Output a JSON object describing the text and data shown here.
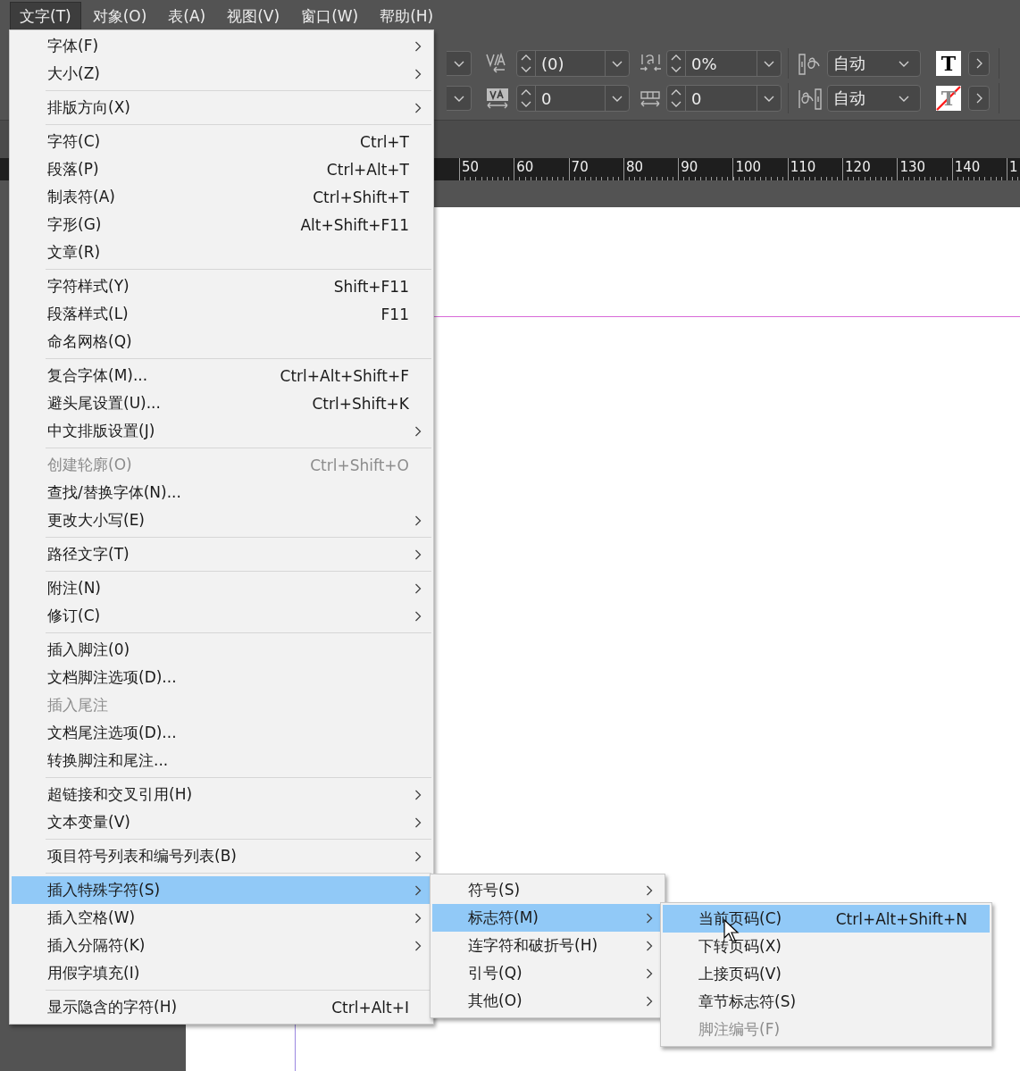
{
  "menubar": [
    {
      "label": "文字(T)",
      "selected": true
    },
    {
      "label": "对象(O)",
      "selected": false
    },
    {
      "label": "表(A)",
      "selected": false
    },
    {
      "label": "视图(V)",
      "selected": false
    },
    {
      "label": "窗口(W)",
      "selected": false
    },
    {
      "label": "帮助(H)",
      "selected": false
    }
  ],
  "control_panel": {
    "rows": [
      {
        "fields": [
          {
            "kind": "spinner",
            "value": "(0)"
          },
          {
            "kind": "spinner",
            "value": "0%"
          },
          {
            "kind": "dropdown",
            "value": "自动"
          }
        ],
        "swatch": {
          "kind": "fill",
          "glyph": "T"
        }
      },
      {
        "fields": [
          {
            "kind": "spinner",
            "value": "0"
          },
          {
            "kind": "spinner",
            "value": "0"
          },
          {
            "kind": "dropdown",
            "value": "自动"
          }
        ],
        "swatch": {
          "kind": "none",
          "glyph": "T"
        }
      }
    ]
  },
  "ruler": {
    "labels": [
      "50",
      "60",
      "70",
      "80",
      "90",
      "100",
      "110",
      "120",
      "130",
      "140",
      "1"
    ]
  },
  "menu": {
    "groups": [
      [
        {
          "label": "字体(F)",
          "submenu": true,
          "disabled": false,
          "selected": false
        },
        {
          "label": "大小(Z)",
          "submenu": true,
          "disabled": false,
          "selected": false
        }
      ],
      [
        {
          "label": "排版方向(X)",
          "submenu": true,
          "disabled": false,
          "selected": false
        }
      ],
      [
        {
          "label": "字符(C)",
          "shortcut": "Ctrl+T",
          "submenu": false,
          "disabled": false,
          "selected": false
        },
        {
          "label": "段落(P)",
          "shortcut": "Ctrl+Alt+T",
          "submenu": false,
          "disabled": false,
          "selected": false
        },
        {
          "label": "制表符(A)",
          "shortcut": "Ctrl+Shift+T",
          "submenu": false,
          "disabled": false,
          "selected": false
        },
        {
          "label": "字形(G)",
          "shortcut": "Alt+Shift+F11",
          "submenu": false,
          "disabled": false,
          "selected": false
        },
        {
          "label": "文章(R)",
          "submenu": false,
          "disabled": false,
          "selected": false
        }
      ],
      [
        {
          "label": "字符样式(Y)",
          "shortcut": "Shift+F11",
          "submenu": false,
          "disabled": false,
          "selected": false
        },
        {
          "label": "段落样式(L)",
          "shortcut": "F11",
          "submenu": false,
          "disabled": false,
          "selected": false
        },
        {
          "label": "命名网格(Q)",
          "submenu": false,
          "disabled": false,
          "selected": false
        }
      ],
      [
        {
          "label": "复合字体(M)...",
          "shortcut": "Ctrl+Alt+Shift+F",
          "submenu": false,
          "disabled": false,
          "selected": false
        },
        {
          "label": "避头尾设置(U)...",
          "shortcut": "Ctrl+Shift+K",
          "submenu": false,
          "disabled": false,
          "selected": false
        },
        {
          "label": "中文排版设置(J)",
          "submenu": true,
          "disabled": false,
          "selected": false
        }
      ],
      [
        {
          "label": "创建轮廓(O)",
          "shortcut": "Ctrl+Shift+O",
          "submenu": false,
          "disabled": true,
          "selected": false
        },
        {
          "label": "查找/替换字体(N)...",
          "submenu": false,
          "disabled": false,
          "selected": false
        },
        {
          "label": "更改大小写(E)",
          "submenu": true,
          "disabled": false,
          "selected": false
        }
      ],
      [
        {
          "label": "路径文字(T)",
          "submenu": true,
          "disabled": false,
          "selected": false
        }
      ],
      [
        {
          "label": "附注(N)",
          "submenu": true,
          "disabled": false,
          "selected": false
        },
        {
          "label": "修订(C)",
          "submenu": true,
          "disabled": false,
          "selected": false
        }
      ],
      [
        {
          "label": "插入脚注(0)",
          "submenu": false,
          "disabled": false,
          "selected": false
        },
        {
          "label": "文档脚注选项(D)...",
          "submenu": false,
          "disabled": false,
          "selected": false
        },
        {
          "label": "插入尾注",
          "submenu": false,
          "disabled": true,
          "selected": false
        },
        {
          "label": "文档尾注选项(D)...",
          "submenu": false,
          "disabled": false,
          "selected": false
        },
        {
          "label": "转换脚注和尾注...",
          "submenu": false,
          "disabled": false,
          "selected": false
        }
      ],
      [
        {
          "label": "超链接和交叉引用(H)",
          "submenu": true,
          "disabled": false,
          "selected": false
        },
        {
          "label": "文本变量(V)",
          "submenu": true,
          "disabled": false,
          "selected": false
        }
      ],
      [
        {
          "label": "项目符号列表和编号列表(B)",
          "submenu": true,
          "disabled": false,
          "selected": false
        }
      ],
      [
        {
          "label": "插入特殊字符(S)",
          "submenu": true,
          "disabled": false,
          "selected": true
        },
        {
          "label": "插入空格(W)",
          "submenu": true,
          "disabled": false,
          "selected": false
        },
        {
          "label": "插入分隔符(K)",
          "submenu": true,
          "disabled": false,
          "selected": false
        },
        {
          "label": "用假字填充(I)",
          "submenu": false,
          "disabled": false,
          "selected": false
        }
      ],
      [
        {
          "label": "显示隐含的字符(H)",
          "shortcut": "Ctrl+Alt+I",
          "submenu": false,
          "disabled": false,
          "selected": false
        }
      ]
    ]
  },
  "submenus": [
    {
      "items": [
        {
          "label": "符号(S)",
          "submenu": true,
          "disabled": false,
          "selected": false
        },
        {
          "label": "标志符(M)",
          "submenu": true,
          "disabled": false,
          "selected": true
        },
        {
          "label": "连字符和破折号(H)",
          "submenu": true,
          "disabled": false,
          "selected": false
        },
        {
          "label": "引号(Q)",
          "submenu": true,
          "disabled": false,
          "selected": false
        },
        {
          "label": "其他(O)",
          "submenu": true,
          "disabled": false,
          "selected": false
        }
      ]
    },
    {
      "items": [
        {
          "label": "当前页码(C)",
          "shortcut": "Ctrl+Alt+Shift+N",
          "submenu": false,
          "disabled": false,
          "selected": true
        },
        {
          "label": "下转页码(X)",
          "submenu": false,
          "disabled": false,
          "selected": false
        },
        {
          "label": "上接页码(V)",
          "submenu": false,
          "disabled": false,
          "selected": false
        },
        {
          "label": "章节标志符(S)",
          "submenu": false,
          "disabled": false,
          "selected": false
        },
        {
          "label": "脚注编号(F)",
          "submenu": false,
          "disabled": true,
          "selected": false
        }
      ]
    }
  ]
}
